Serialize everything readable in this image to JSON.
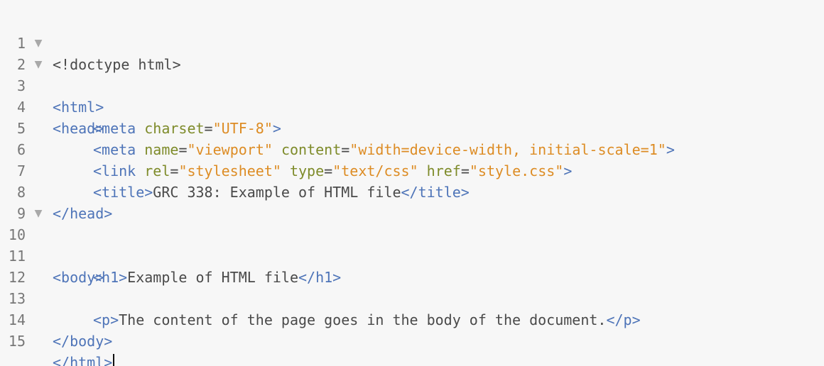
{
  "editor": {
    "lines": [
      {
        "num": "1",
        "parts": [
          "<!doctype html>"
        ]
      },
      {
        "num": "2",
        "fold": "▼",
        "parts": [
          "<html>"
        ]
      },
      {
        "num": "3",
        "fold": "▼",
        "parts": [
          "<head>"
        ]
      },
      {
        "num": "4",
        "parts": [
          "<meta",
          " charset",
          "=",
          "\"UTF-8\"",
          ">"
        ]
      },
      {
        "num": "5",
        "parts": [
          "<meta",
          " name",
          "=",
          "\"viewport\"",
          " content",
          "=",
          "\"width=device-width, initial-scale=1\"",
          ">"
        ]
      },
      {
        "num": "6",
        "parts": [
          "<link",
          " rel",
          "=",
          "\"stylesheet\"",
          " type",
          "=",
          "\"text/css\"",
          " href",
          "=",
          "\"style.css\"",
          ">"
        ]
      },
      {
        "num": "7",
        "parts": [
          "<title>",
          "GRC 338: Example of HTML file",
          "</title>"
        ]
      },
      {
        "num": "8",
        "parts": [
          "</head>"
        ]
      },
      {
        "num": "9",
        "parts": []
      },
      {
        "num": "10",
        "fold": "▼",
        "parts": [
          "<body>"
        ]
      },
      {
        "num": "11",
        "parts": [
          "<h1>",
          "Example of HTML file",
          "</h1>"
        ]
      },
      {
        "num": "12",
        "parts": []
      },
      {
        "num": "13",
        "parts": [
          "<p>",
          "The content of the page goes in the body of the document.",
          "</p>"
        ]
      },
      {
        "num": "14",
        "parts": [
          "</body>"
        ]
      },
      {
        "num": "15",
        "parts": [
          "</html>"
        ]
      }
    ]
  },
  "colors": {
    "tag": "#4e74b8",
    "attribute": "#7e8b2a",
    "value": "#dd8c24",
    "text": "#4a4a4a",
    "background": "#f7f7f7"
  }
}
